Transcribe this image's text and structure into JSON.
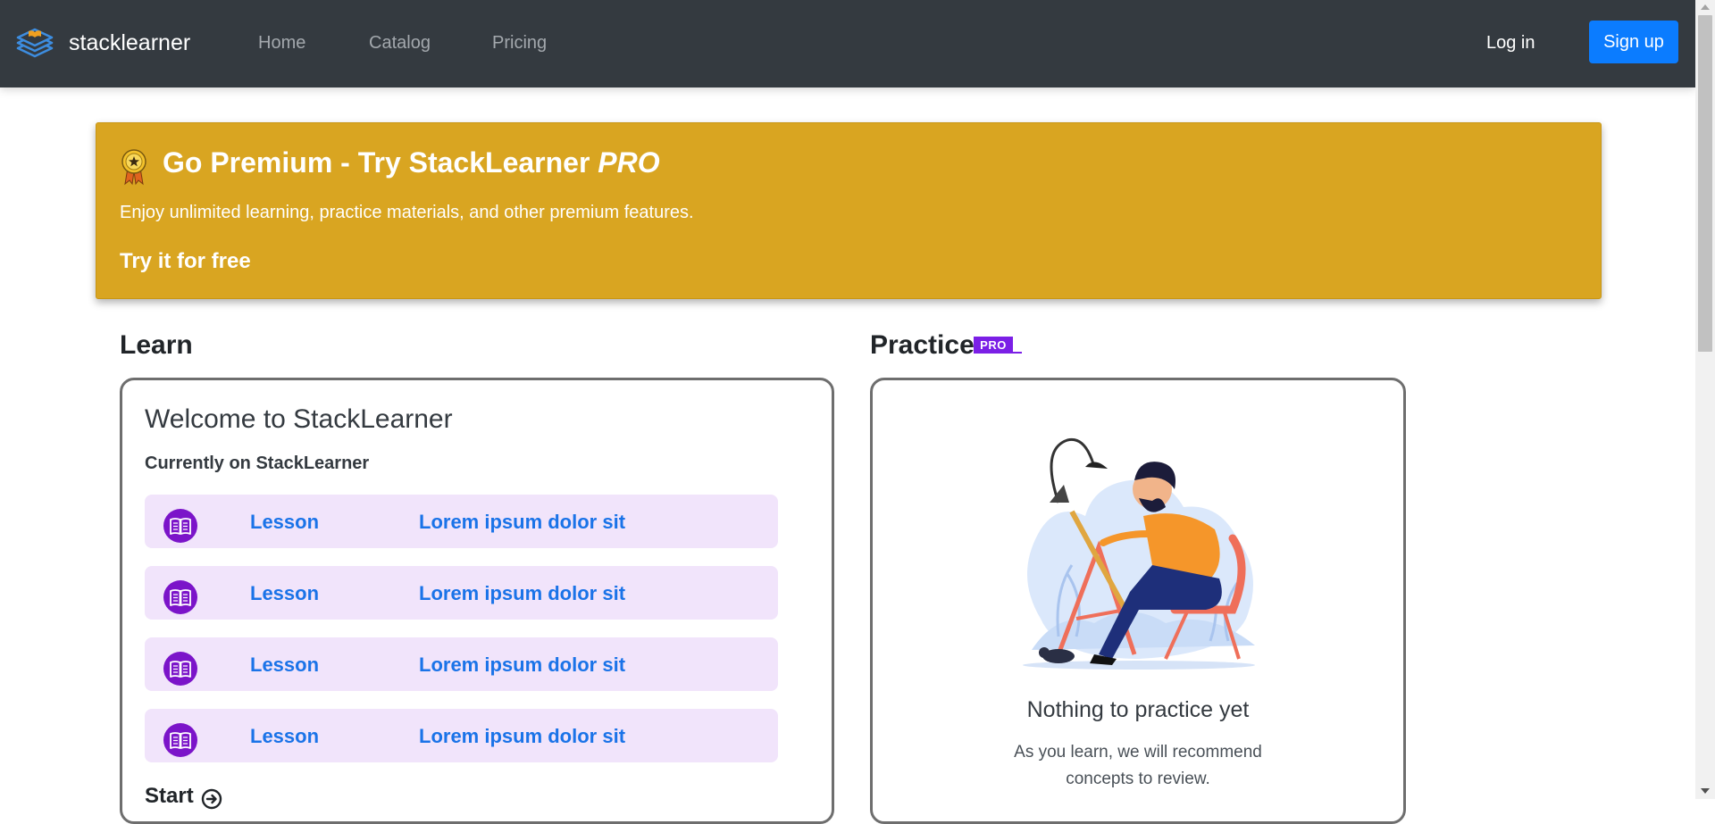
{
  "navbar": {
    "brand": "stacklearner",
    "links": [
      "Home",
      "Catalog",
      "Pricing"
    ],
    "login_label": "Log in",
    "signup_label": "Sign up"
  },
  "banner": {
    "title_main": "Go Premium - Try StackLearner ",
    "title_em": "PRO",
    "description": "Enjoy unlimited learning, practice materials, and other premium features.",
    "cta": "Try it for free"
  },
  "learn": {
    "heading": "Learn",
    "welcome": "Welcome to StackLearner",
    "currently": "Currently on StackLearner",
    "lessons": [
      {
        "type": "Lesson",
        "title": "Lorem ipsum dolor sit"
      },
      {
        "type": "Lesson",
        "title": "Lorem ipsum dolor sit"
      },
      {
        "type": "Lesson",
        "title": "Lorem ipsum dolor sit"
      },
      {
        "type": "Lesson",
        "title": "Lorem ipsum dolor sit"
      }
    ],
    "start_label": "Start"
  },
  "practice": {
    "heading": "Practice",
    "badge": "PRO",
    "empty_title": "Nothing to practice yet",
    "empty_desc": "As you learn, we will recommend concepts to review."
  },
  "colors": {
    "navbar_bg": "#343a40",
    "accent_blue": "#0b7cff",
    "banner_gold": "#d9a521",
    "pro_purple": "#7b1fe6",
    "lesson_row_bg": "#f1e4fb",
    "link_blue": "#1a73e8"
  },
  "icons": {
    "logo": "layers-book-icon",
    "banner": "medal-icon",
    "lesson": "open-book-icon",
    "start": "arrow-right-circle-icon"
  }
}
